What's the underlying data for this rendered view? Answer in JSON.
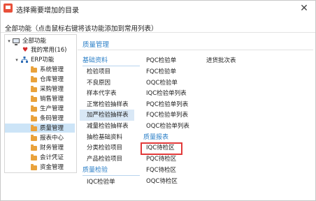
{
  "window": {
    "title": "选择需要增加的目录",
    "hint": "全部功能（点击鼠标右键将该功能添加到常用列表）"
  },
  "tree": {
    "root": "全部功能",
    "favorites": "我的常用(16)",
    "erp": "ERP功能",
    "items": [
      "系统管理",
      "仓库管理",
      "采购管理",
      "销售管理",
      "生产管理",
      "条码管理",
      "质量管理",
      "报表中心",
      "财务管理",
      "会计凭证",
      "资金管理"
    ],
    "selected": "质量管理"
  },
  "panel": {
    "title": "质量管理",
    "col1": {
      "category": "基础资料",
      "items": [
        "检验项目",
        "不良原因",
        "样本代字表",
        "正常检验抽样表",
        "加严检验抽样表",
        "减量检验抽样表",
        "抽检基础资料",
        "分类检验项目",
        "产品检验项目"
      ],
      "highlighted": "加严检验抽样表",
      "category2": "质量检验",
      "items2": [
        "IQC检验单"
      ]
    },
    "col2": {
      "items": [
        "PQC检验单",
        "FQC检验单",
        "OQC检验单",
        "IQC检验单列表",
        "PQC检验单列表",
        "FQC检验单列表",
        "OQC检验单列表"
      ],
      "category": "质量报表",
      "report_items": [
        "IQC待检区",
        "PQC待检区",
        "FQC待检区",
        "OQC待检区"
      ],
      "boxed": "IQC待检区"
    },
    "col3": {
      "items": [
        "进货批次表"
      ]
    }
  },
  "colors": {
    "accent": "#2b7fc7",
    "selection": "#cce4f7",
    "highlight_box": "#e23a3a",
    "folder": "#e9a23b"
  }
}
